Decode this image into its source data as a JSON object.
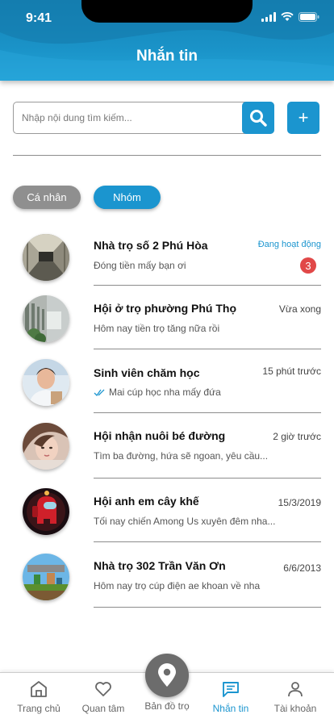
{
  "status_bar": {
    "time": "9:41"
  },
  "header": {
    "title": "Nhắn tin"
  },
  "search": {
    "placeholder": "Nhập nội dung tìm kiếm...",
    "value": "",
    "add_label": "+"
  },
  "filters": {
    "personal": "Cá nhân",
    "group": "Nhóm",
    "selected": "Nhóm"
  },
  "conversations": [
    {
      "name": "Nhà trọ số 2 Phú Hòa",
      "time": "Đang hoạt động",
      "message": "Đóng tiền mấy bạn ơi",
      "unread": "3",
      "avatar": "hallway-photo"
    },
    {
      "name": "Hội ở trọ phường Phú Thọ",
      "time": "Vừa xong",
      "message": "Hôm nay tiền trọ tăng nữa rồi",
      "avatar": "dormitory-photo"
    },
    {
      "name": "Sinh viên chăm học",
      "time": "15 phút trước",
      "message": "Mai cúp học nha mấy đứa",
      "seen": true,
      "avatar": "student-photo"
    },
    {
      "name": "Hội nhận nuôi bé đường",
      "time": "2 giờ trước",
      "message": "Tìm ba đường, hứa sẽ ngoan, yêu cầu...",
      "avatar": "girl-photo"
    },
    {
      "name": "Hội anh em cây khế",
      "time": "15/3/2019",
      "message": "Tối nay chiến Among Us xuyên đêm nha...",
      "avatar": "among-us-photo"
    },
    {
      "name": "Nhà trọ 302 Trần Văn Ơn",
      "time": "6/6/2013",
      "message": "Hôm nay trọ cúp điện ae khoan về nha",
      "avatar": "minecraft-photo"
    }
  ],
  "bottom_nav": {
    "home": "Trang chủ",
    "favorites": "Quan tâm",
    "map": "Bản đồ trọ",
    "messages": "Nhắn tin",
    "account": "Tài khoản",
    "active": "Nhắn tin"
  },
  "colors": {
    "primary": "#1b95cf",
    "badge": "#e14848",
    "inactive_pill": "#8f8f8f"
  }
}
